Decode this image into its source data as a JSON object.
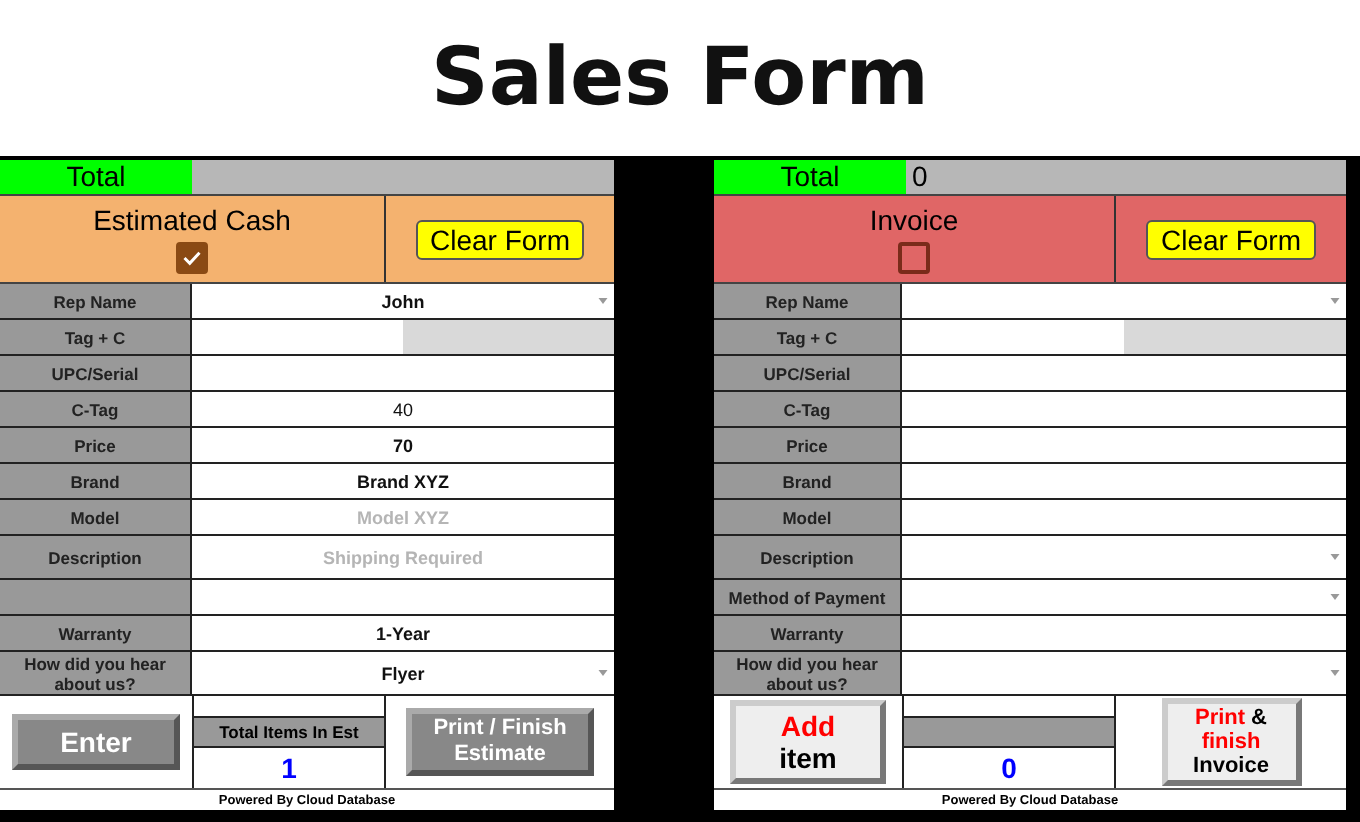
{
  "title": "Sales Form",
  "forms": [
    {
      "total": {
        "label": "Total"
      },
      "header": {
        "label": "Estimated Cash",
        "checked": true,
        "color": "#f4b26f"
      },
      "clear_button": "Clear Form",
      "rows": [
        {
          "label": "Rep Name",
          "value": "John",
          "bold": true,
          "dropdown": true
        },
        {
          "label": "Tag + C",
          "split": true
        },
        {
          "label": "UPC/Serial"
        },
        {
          "label": "C-Tag",
          "value": "40",
          "bold": false
        },
        {
          "label": "Price",
          "value": "70",
          "bold": true
        },
        {
          "label": "Brand",
          "value": "Brand XYZ",
          "bold": true
        },
        {
          "label": "Model",
          "placeholder": "Model XYZ"
        },
        {
          "label": "Description",
          "placeholder": "Shipping Required",
          "tall": true
        },
        {},
        {
          "label": "Warranty",
          "value": "1-Year",
          "bold": true
        },
        {
          "label": "How did you hear about us?",
          "value": "Flyer",
          "bold": true,
          "dropdown": true,
          "tall": true
        }
      ],
      "enter_button": {
        "kind": "dark",
        "parts": [
          {
            "text": "Enter",
            "color": "#ffffff"
          }
        ]
      },
      "counter": {
        "label": "Total Items In Est",
        "value": "1"
      },
      "finish_button": {
        "kind": "dark",
        "parts": [
          {
            "text": "Print / Finish Estimate",
            "color": "#ffffff"
          }
        ]
      },
      "footer": "Powered By Cloud Database"
    },
    {
      "total": {
        "label": "Total",
        "value": "0"
      },
      "header": {
        "label": "Invoice",
        "checked": false,
        "color": "#e06666"
      },
      "clear_button": "Clear Form",
      "rows": [
        {
          "label": "Rep Name",
          "dropdown": true
        },
        {
          "label": "Tag + C",
          "split": true
        },
        {
          "label": "UPC/Serial"
        },
        {
          "label": "C-Tag"
        },
        {
          "label": "Price"
        },
        {
          "label": "Brand"
        },
        {
          "label": "Model"
        },
        {
          "label": "Description",
          "dropdown": true,
          "tall": true
        },
        {
          "label": "Method of Payment",
          "dropdown": true
        },
        {
          "label": "Warranty"
        },
        {
          "label": "How did you hear about us?",
          "dropdown": true,
          "tall": true
        }
      ],
      "enter_button": {
        "kind": "light",
        "parts": [
          {
            "text": "Add",
            "color": "#ff0000"
          },
          {
            "text": "item",
            "color": "#000000"
          }
        ]
      },
      "counter": {
        "value": "0"
      },
      "finish_button": {
        "kind": "light",
        "parts": [
          {
            "text": "Print",
            "color": "#ff0000"
          },
          {
            "text": "&",
            "color": "#000000"
          },
          {
            "text": "finish",
            "color": "#ff0000"
          },
          {
            "text": "Invoice",
            "color": "#000000"
          }
        ]
      },
      "footer": "Powered By Cloud Database"
    }
  ]
}
